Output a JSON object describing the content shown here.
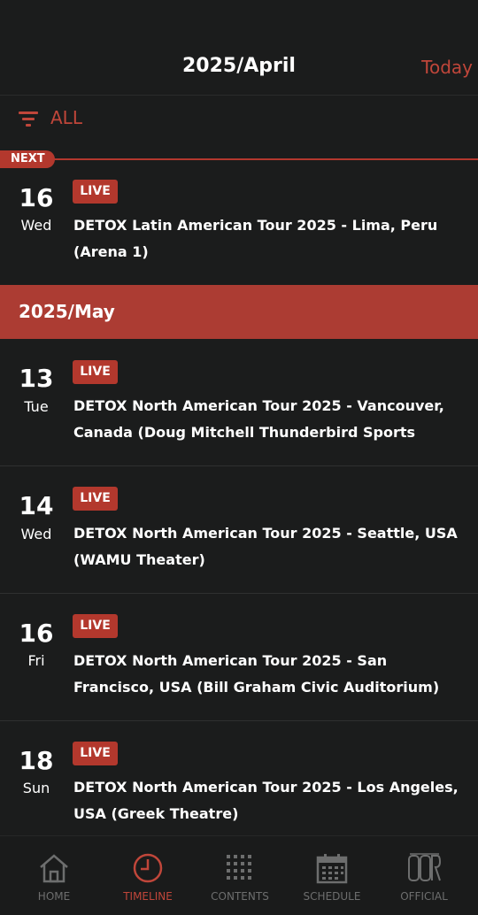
{
  "header": {
    "title": "2025/April",
    "today_label": "Today"
  },
  "filter": {
    "label": "ALL"
  },
  "next_badge": "NEXT",
  "april_events": [
    {
      "day": "16",
      "weekday": "Wed",
      "tag": "LIVE",
      "title": "DETOX Latin American Tour 2025 - Lima, Peru (Arena 1)"
    }
  ],
  "month_header": "2025/May",
  "may_events": [
    {
      "day": "13",
      "weekday": "Tue",
      "tag": "LIVE",
      "title": "DETOX North American Tour 2025 - Vancouver, Canada (Doug Mitchell Thunderbird Sports"
    },
    {
      "day": "14",
      "weekday": "Wed",
      "tag": "LIVE",
      "title": "DETOX North American Tour 2025 - Seattle, USA (WAMU Theater)"
    },
    {
      "day": "16",
      "weekday": "Fri",
      "tag": "LIVE",
      "title": "DETOX North American Tour 2025 - San Francisco, USA (Bill Graham Civic Auditorium)"
    },
    {
      "day": "18",
      "weekday": "Sun",
      "tag": "LIVE",
      "title": "DETOX North American Tour 2025 - Los Angeles, USA (Greek Theatre)"
    }
  ],
  "tabs": [
    {
      "label": "HOME",
      "icon": "home-icon"
    },
    {
      "label": "TIMELINE",
      "icon": "clock-icon",
      "active": true
    },
    {
      "label": "CONTENTS",
      "icon": "grid-icon"
    },
    {
      "label": "SCHEDULE",
      "icon": "calendar-icon"
    },
    {
      "label": "OFFICIAL",
      "icon": "logo-icon"
    }
  ],
  "colors": {
    "background": "#1b1c1c",
    "accent": "#b3382d",
    "month_bar": "#ac3c33",
    "inactive_tab": "#6d6e6e"
  }
}
